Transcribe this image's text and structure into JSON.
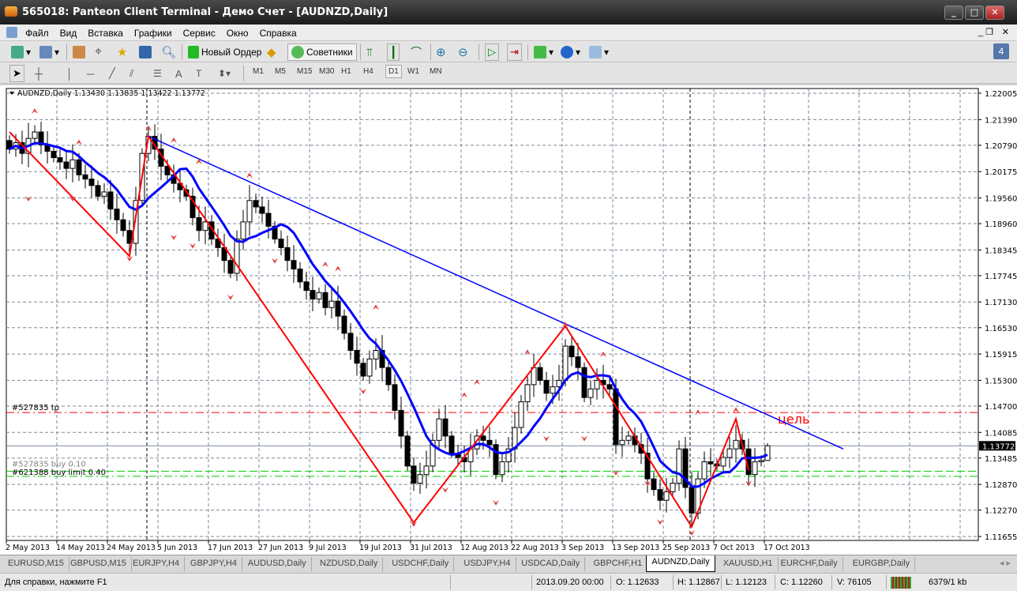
{
  "window": {
    "title": "565018: Panteon Client Terminal - Демо Счет - [AUDNZD,Daily]",
    "notification_count": "4"
  },
  "menu": [
    "Файл",
    "Вид",
    "Вставка",
    "Графики",
    "Сервис",
    "Окно",
    "Справка"
  ],
  "toolbar": {
    "new_order": "Новый Ордер",
    "advisors": "Советники"
  },
  "timeframes": [
    "M1",
    "M5",
    "M15",
    "M30",
    "H1",
    "H4",
    "D1",
    "W1",
    "MN"
  ],
  "active_timeframe": "D1",
  "chart": {
    "header": "AUDNZD,Daily  1.13430 1.13835 1.13422 1.13772",
    "tp_label": "#527835 tp",
    "buy_label": "#527835 buy 0.10",
    "limit_label": "#621388 buy limit 0.40",
    "target_label": "цель",
    "current_price": "1.13772",
    "price_ticks": [
      "1.22005",
      "1.21390",
      "1.20790",
      "1.20175",
      "1.19560",
      "1.18960",
      "1.18345",
      "1.17745",
      "1.17130",
      "1.16530",
      "1.15915",
      "1.15300",
      "1.14700",
      "1.14085",
      "1.13485",
      "1.12870",
      "1.12270",
      "1.11655"
    ],
    "date_ticks": [
      "2 May 2013",
      "14 May 2013",
      "24 May 2013",
      "5 Jun 2013",
      "17 Jun 2013",
      "27 Jun 2013",
      "9 Jul 2013",
      "19 Jul 2013",
      "31 Jul 2013",
      "12 Aug 2013",
      "22 Aug 2013",
      "3 Sep 2013",
      "13 Sep 2013",
      "25 Sep 2013",
      "7 Oct 2013",
      "17 Oct 2013"
    ],
    "colors": {
      "bull": "#ffffff",
      "bear": "#000000",
      "ma": "#0000ff",
      "zigzag": "#ff0000",
      "trend": "#0000ff",
      "tp": "#ff0000",
      "limit": "#00cc00"
    }
  },
  "chart_data": {
    "type": "candlestick",
    "symbol": "AUDNZD",
    "timeframe": "Daily",
    "ylim": [
      1.11655,
      1.22005
    ],
    "last_bar": {
      "open": 1.1343,
      "high": 1.13835,
      "low": 1.13422,
      "close": 1.13772
    },
    "closes": [
      1.207,
      1.2085,
      1.206,
      1.2095,
      1.211,
      1.208,
      1.2065,
      1.205,
      1.204,
      1.2025,
      1.2045,
      1.201,
      1.2,
      1.1985,
      1.196,
      1.197,
      1.193,
      1.1905,
      1.188,
      1.185,
      1.195,
      1.206,
      1.21,
      1.207,
      1.203,
      1.201,
      1.199,
      1.1975,
      1.196,
      1.191,
      1.188,
      1.19,
      1.186,
      1.184,
      1.181,
      1.178,
      1.186,
      1.19,
      1.195,
      1.1935,
      1.192,
      1.189,
      1.186,
      1.184,
      1.181,
      1.179,
      1.176,
      1.174,
      1.172,
      1.1735,
      1.17,
      1.1715,
      1.168,
      1.164,
      1.16,
      1.157,
      1.154,
      1.158,
      1.16,
      1.156,
      1.152,
      1.146,
      1.14,
      1.133,
      1.129,
      1.131,
      1.133,
      1.139,
      1.144,
      1.14,
      1.136,
      1.135,
      1.134,
      1.137,
      1.14,
      1.139,
      1.138,
      1.131,
      1.134,
      1.137,
      1.142,
      1.148,
      1.152,
      1.156,
      1.153,
      1.15,
      1.1515,
      1.153,
      1.161,
      1.1585,
      1.156,
      1.149,
      1.151,
      1.153,
      1.152,
      1.151,
      1.138,
      1.139,
      1.14,
      1.138,
      1.136,
      1.13,
      1.1275,
      1.125,
      1.127,
      1.129,
      1.137,
      1.128,
      1.122,
      1.13,
      1.134,
      1.1335,
      1.133,
      1.135,
      1.137,
      1.139,
      1.137,
      1.131,
      1.134,
      1.1343,
      1.13772
    ],
    "first_open": 1.209,
    "ma_period": 8,
    "zigzag": [
      [
        0,
        1.211
      ],
      [
        19,
        1.182
      ],
      [
        22,
        1.21
      ],
      [
        64,
        1.1198
      ],
      [
        88,
        1.1657
      ],
      [
        108,
        1.1188
      ],
      [
        115,
        1.144
      ],
      [
        117,
        1.132
      ]
    ],
    "trendline": [
      [
        22,
        1.21
      ],
      [
        132,
        1.137
      ]
    ],
    "levels": {
      "tp": 1.1455,
      "buy": 1.1318,
      "limit": 1.1306,
      "current": 1.13772
    },
    "fractals_up": [
      [
        4,
        1.2158
      ],
      [
        11,
        1.2085
      ],
      [
        22,
        1.2118
      ],
      [
        26,
        1.209
      ],
      [
        30,
        1.204
      ],
      [
        38,
        1.2008
      ],
      [
        50,
        1.18
      ],
      [
        52,
        1.179
      ],
      [
        58,
        1.17
      ],
      [
        72,
        1.1495
      ],
      [
        74,
        1.1525
      ],
      [
        82,
        1.1595
      ],
      [
        88,
        1.166
      ],
      [
        94,
        1.159
      ],
      [
        109,
        1.1455
      ],
      [
        115,
        1.146
      ]
    ],
    "fractals_down": [
      [
        3,
        1.1955
      ],
      [
        10,
        1.1955
      ],
      [
        19,
        1.1815
      ],
      [
        26,
        1.1865
      ],
      [
        29,
        1.1845
      ],
      [
        35,
        1.1725
      ],
      [
        42,
        1.181
      ],
      [
        56,
        1.1505
      ],
      [
        64,
        1.1195
      ],
      [
        69,
        1.1275
      ],
      [
        77,
        1.1245
      ],
      [
        85,
        1.1395
      ],
      [
        91,
        1.1395
      ],
      [
        96,
        1.1315
      ],
      [
        101,
        1.129
      ],
      [
        103,
        1.12
      ],
      [
        108,
        1.1175
      ],
      [
        117,
        1.129
      ]
    ]
  },
  "tabs": [
    "EURUSD,M15",
    "GBPUSD,M15",
    "EURJPY,H4",
    "GBPJPY,H4",
    "AUDUSD,Daily",
    "NZDUSD,Daily",
    "USDCHF,Daily",
    "USDJPY,H4",
    "USDCAD,Daily",
    "GBPCHF,H1",
    "AUDNZD,Daily",
    "XAUUSD,H1",
    "EURCHF,Daily",
    "EURGBP,Daily"
  ],
  "active_tab": "AUDNZD,Daily",
  "status": {
    "help": "Для справки, нажмите F1",
    "datetime": "2013.09.20 00:00",
    "open": "O: 1.12633",
    "high": "H: 1.12867",
    "low": "L: 1.12123",
    "close": "C: 1.12260",
    "volume": "V: 76105",
    "traffic": "6379/1 kb"
  }
}
